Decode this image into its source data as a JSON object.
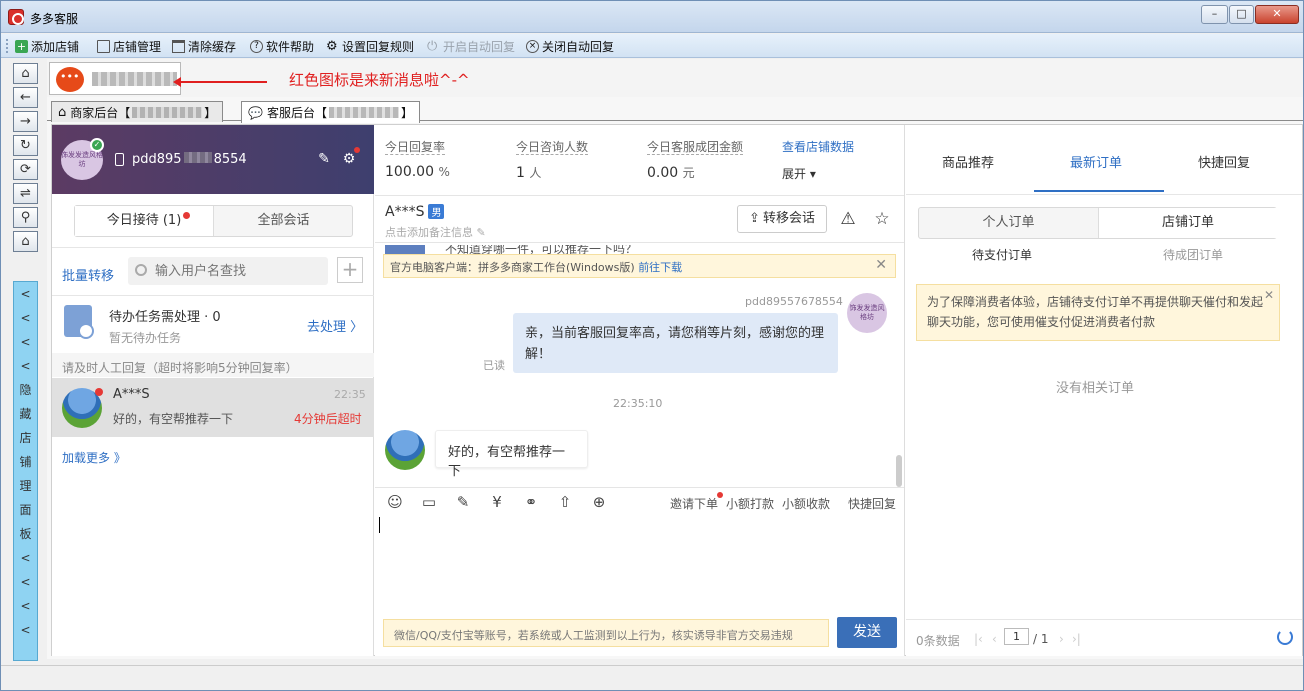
{
  "window": {
    "title": "多多客服",
    "min": "–",
    "max": "□",
    "close": "✕"
  },
  "toolbar": {
    "add_shop": "添加店铺",
    "shop_manage": "店铺管理",
    "clear_cache": "清除缓存",
    "help": "软件帮助",
    "reply_rules": "设置回复规则",
    "auto_reply_on": "开启自动回复",
    "auto_reply_off": "关闭自动回复"
  },
  "left_strip": {
    "home": "⌂",
    "back": "←",
    "forward": "→",
    "reload": "↻",
    "sync": "⟳",
    "swap": "⇌",
    "search": "⚲",
    "house": "⌂",
    "hide_label": [
      "<",
      "<",
      "<",
      "<",
      "隐",
      "藏",
      "店",
      "铺",
      "理",
      "面",
      "板",
      "<",
      "<",
      "<",
      "<"
    ]
  },
  "shop_row": {
    "hint": "红色图标是来新消息啦^-^"
  },
  "back_tabs": {
    "merchant": "商家后台【",
    "merchant_end": "】",
    "service": "客服后台【",
    "service_end": "】"
  },
  "store": {
    "avatar_text": "饰发发造风格坊",
    "id": "pdd895",
    "id_end": "8554"
  },
  "reception": {
    "today": "今日接待 (1)",
    "all": "全部会话"
  },
  "bulk_transfer": "批量转移",
  "search": {
    "placeholder": "输入用户名查找"
  },
  "add_icon": "+",
  "todo": {
    "title": "待办任务需处理 · 0",
    "sub": "暂无待办任务",
    "go": "去处理 〉"
  },
  "wait_tip": "请及时人工回复（超时将影响5分钟回复率）",
  "conversation": {
    "name": "A***S",
    "time": "22:35",
    "msg": "好的，有空帮推荐一下",
    "warn": "4分钟后超时"
  },
  "load_more": "加载更多 》",
  "stats": {
    "reply_rate_label": "今日回复率",
    "reply_rate": "100.00",
    "reply_rate_unit": "%",
    "consult_label": "今日咨询人数",
    "consult": "1",
    "consult_unit": "人",
    "amount_label": "今日客服成团金额",
    "amount": "0.00",
    "amount_unit": "元",
    "view_data": "查看店铺数据",
    "expand": "展开 ▾"
  },
  "chat": {
    "customer": "A***S",
    "gender": "男",
    "remark": "点击添加备注信息 ✎",
    "transfer": "转移会话",
    "warn_icon": "⚠",
    "star_icon": "☆",
    "prev_text": "不知道穿哪一件，可以推荐一下吗？",
    "notice": "官方电脑客户端：拼多多商家工作台(Windows版) ",
    "notice_link": "前往下载",
    "notice_close": "✕",
    "sender": "pdd89557678554",
    "my_msg": "亲，当前客服回复率高，请您稍等片刻，感谢您的理解！",
    "read": "已读",
    "timestamp": "22:35:10",
    "cust_msg": "好的，有空帮推荐一下"
  },
  "input_toolbar": {
    "invite": "邀请下单",
    "small_pay": "小额打款",
    "small_collect": "小额收款",
    "quick_reply": "快捷回复"
  },
  "input_warn": "微信/QQ/支付宝等账号，若系统或人工监测到以上行为，核实诱导非官方交易违规",
  "send": "发送",
  "right": {
    "tab_goods": "商品推荐",
    "tab_orders": "最新订单",
    "tab_quick": "快捷回复",
    "personal": "个人订单",
    "shop": "店铺订单",
    "pending_pay": "待支付订单",
    "pending_group": "待成团订单",
    "notice": "为了保障消费者体验，店铺待支付订单不再提供聊天催付和发起聊天功能，您可使用催支付促进消费者付款",
    "notice_close": "✕",
    "empty": "没有相关订单",
    "count": "0条数据",
    "page": "1",
    "total": "/ 1"
  }
}
